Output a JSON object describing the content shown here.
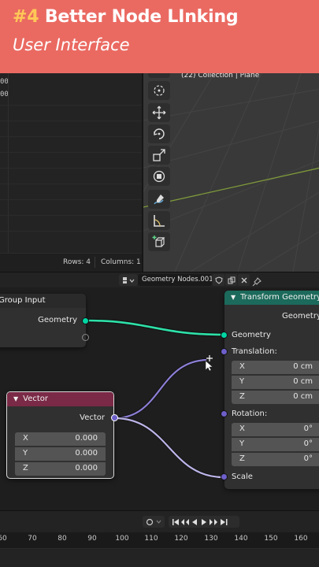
{
  "banner": {
    "number": "#4",
    "title": "Better Node LInking",
    "subtitle": "User Interface"
  },
  "spreadsheet": {
    "partial_values": [
      "00",
      "00"
    ],
    "rows_label": "Rows: 4",
    "columns_label": "Columns: 1"
  },
  "viewport": {
    "collection_label": "(22) Collection | Plane",
    "tools": [
      "cursor-icon",
      "move-icon",
      "rotate-icon",
      "scale-icon",
      "transform-icon",
      "annotate-icon",
      "measure-icon",
      "add-cube-icon"
    ]
  },
  "node_editor": {
    "tree_name": "Geometry Nodes.001"
  },
  "nodes": {
    "group_input": {
      "title": "Group Input",
      "output_geometry": "Geometry",
      "color": "#2e2e2e"
    },
    "vector": {
      "title": "Vector",
      "output": "Vector",
      "header_color": "#7a2a46",
      "fields": [
        {
          "key": "X",
          "value": "0.000"
        },
        {
          "key": "Y",
          "value": "0.000"
        },
        {
          "key": "Z",
          "value": "0.000"
        }
      ]
    },
    "transform": {
      "title": "Transform Geometry",
      "header_color": "#1c6a5b",
      "output_geometry": "Geometry",
      "input_geometry": "Geometry",
      "translation_label": "Translation:",
      "translation": [
        {
          "key": "X",
          "value": "0 cm"
        },
        {
          "key": "Y",
          "value": "0 cm"
        },
        {
          "key": "Z",
          "value": "0 cm"
        }
      ],
      "rotation_label": "Rotation:",
      "rotation": [
        {
          "key": "X",
          "value": "0°"
        },
        {
          "key": "Y",
          "value": "0°"
        },
        {
          "key": "Z",
          "value": "0°"
        }
      ],
      "scale_label": "Scale"
    }
  },
  "colors": {
    "banner": "#ea6a62",
    "accent": "#ffc857",
    "geometry_socket": "#00d6a3",
    "vector_socket": "#6d5fc9"
  },
  "timeline": {
    "ticks": [
      "60",
      "70",
      "80",
      "90",
      "100",
      "110",
      "120",
      "130",
      "140",
      "150",
      "160"
    ]
  }
}
